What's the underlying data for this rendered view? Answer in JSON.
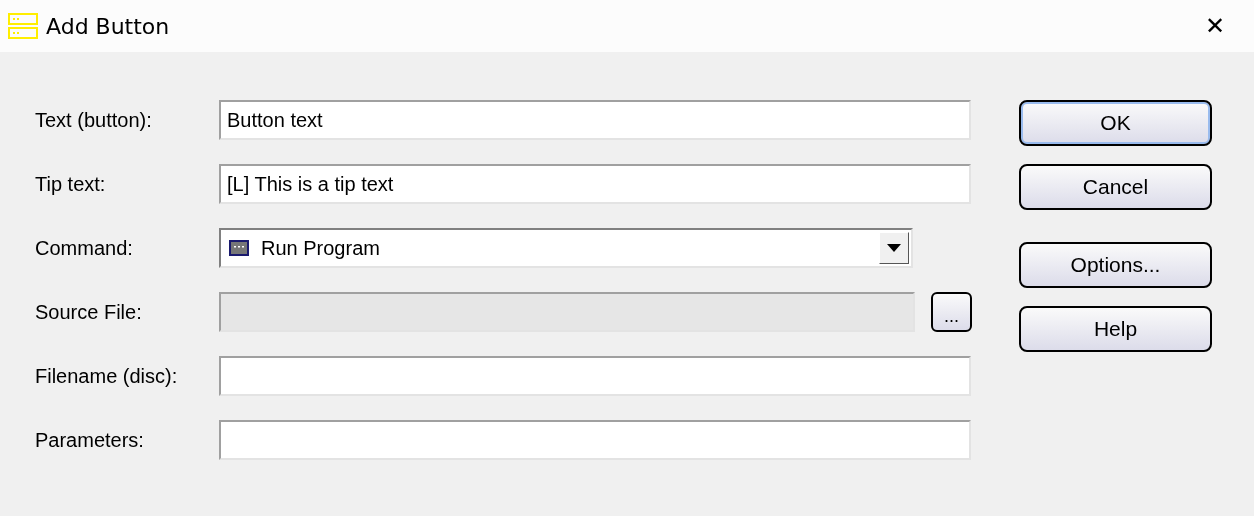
{
  "window": {
    "title": "Add Button",
    "close": "✕"
  },
  "fields": [
    {
      "kind": "text",
      "label": "Text (button):",
      "value": "Button text",
      "disabled": false
    },
    {
      "kind": "text",
      "label": "Tip text:",
      "value": "[L] This is a tip text",
      "disabled": false
    },
    {
      "kind": "dropdown",
      "label": "Command:",
      "value": "Run Program",
      "disabled": false
    },
    {
      "kind": "browse",
      "label": "Source File:",
      "disabled": true,
      "button": "..."
    },
    {
      "kind": "text",
      "label": "Filename (disc):",
      "disabled": false
    },
    {
      "kind": "text",
      "label": "Parameters:",
      "disabled": false
    }
  ],
  "buttons": [
    {
      "label": "OK",
      "default": true
    },
    {
      "label": "Cancel",
      "default": false
    }
  ],
  "extra_buttons": [
    {
      "label": "Options...",
      "default": false
    },
    {
      "label": "Help",
      "default": false
    }
  ]
}
